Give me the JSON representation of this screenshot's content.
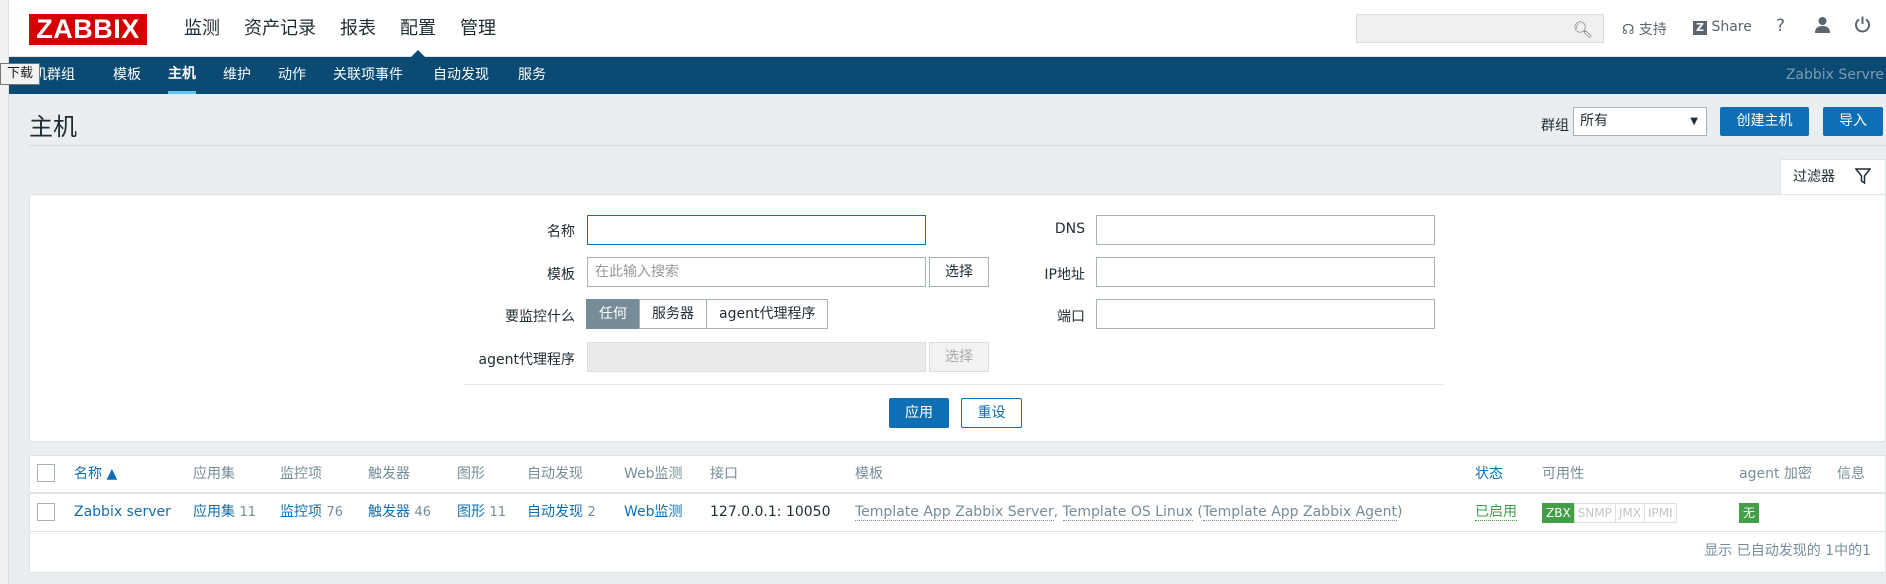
{
  "brand": {
    "logo_text": "ZABBIX",
    "logo_color": "#d40000"
  },
  "main_menu": [
    {
      "label": "监测"
    },
    {
      "label": "资产记录"
    },
    {
      "label": "报表"
    },
    {
      "label": "配置",
      "active": true
    },
    {
      "label": "管理"
    }
  ],
  "top_right": {
    "search_placeholder": "",
    "support_label": "支持",
    "share_label": "Share",
    "help_glyph": "?"
  },
  "tooltip": "下载",
  "sub_menu": [
    {
      "label": "机群组"
    },
    {
      "label": "模板"
    },
    {
      "label": "主机",
      "active": true
    },
    {
      "label": "维护"
    },
    {
      "label": "动作"
    },
    {
      "label": "关联项事件"
    },
    {
      "label": "自动发现"
    },
    {
      "label": "服务"
    }
  ],
  "server_name": "Zabbix Servre",
  "page": {
    "title": "主机",
    "group_label": "群组",
    "group_value": "所有",
    "create_button": "创建主机",
    "import_button": "导入"
  },
  "filter": {
    "tab_label": "过滤器",
    "name_label": "名称",
    "name_value": "",
    "template_label": "模板",
    "template_placeholder": "在此输入搜索",
    "select_label": "选择",
    "monitor_label": "要监控什么",
    "monitor_options": [
      "任何",
      "服务器",
      "agent代理程序"
    ],
    "monitor_selected": "任何",
    "proxy_label": "agent代理程序",
    "proxy_select_label": "选择",
    "dns_label": "DNS",
    "ip_label": "IP地址",
    "port_label": "端口",
    "apply_button": "应用",
    "reset_button": "重设"
  },
  "table": {
    "headers": {
      "name": "名称 ▲",
      "apps": "应用集",
      "items": "监控项",
      "triggers": "触发器",
      "graphs": "图形",
      "discovery": "自动发现",
      "web": "Web监测",
      "interface": "接口",
      "templates": "模板",
      "status": "状态",
      "availability": "可用性",
      "encryption": "agent 加密",
      "info": "信息"
    },
    "rows": [
      {
        "name": "Zabbix server",
        "apps_label": "应用集",
        "apps_count": "11",
        "items_label": "监控项",
        "items_count": "76",
        "triggers_label": "触发器",
        "triggers_count": "46",
        "graphs_label": "图形",
        "graphs_count": "11",
        "discovery_label": "自动发现",
        "discovery_count": "2",
        "web_label": "Web监测",
        "interface": "127.0.0.1: 10050",
        "template1": "Template App Zabbix Server",
        "sep1": ", ",
        "template2": "Template OS Linux",
        "paren_open": " (",
        "template3": "Template App Zabbix Agent",
        "paren_close": ")",
        "status": "已启用",
        "availability": [
          "ZBX",
          "SNMP",
          "JMX",
          "IPMI"
        ],
        "encryption": "无"
      }
    ],
    "footer": "显示 已自动发现的 1中的1"
  },
  "colors": {
    "nav_bg": "#0b4a73",
    "primary": "#0f6fb4",
    "status_green": "#429e47"
  }
}
